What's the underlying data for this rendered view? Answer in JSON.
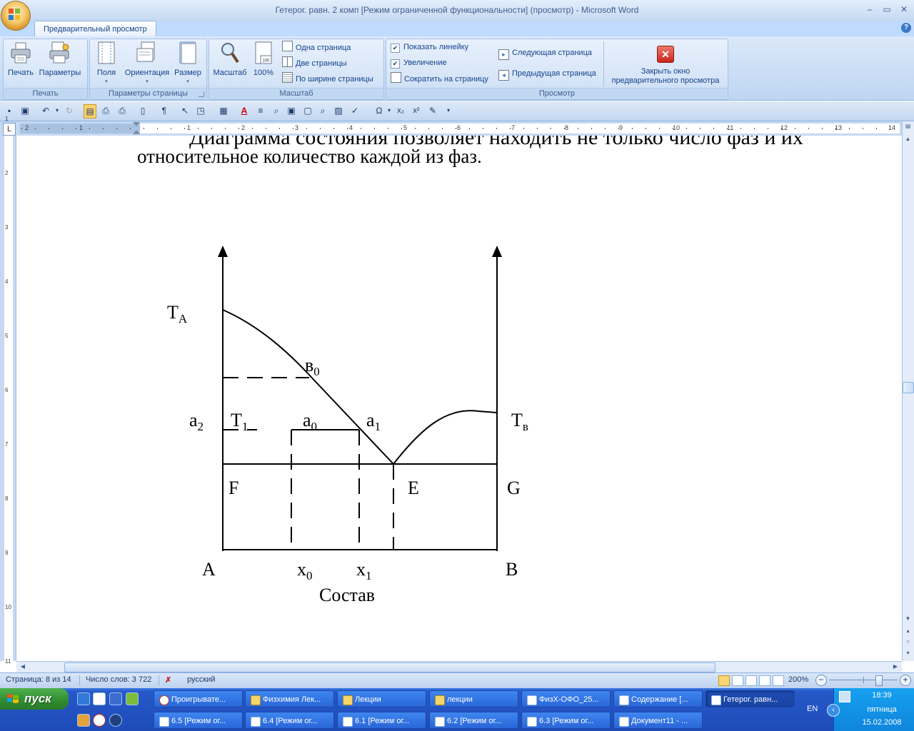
{
  "window": {
    "title": "Гетерог. равн. 2 комп [Режим ограниченной функциональности] (просмотр) - Microsoft Word",
    "minimize": "–",
    "restore": "▭",
    "close": "✕"
  },
  "ribbon": {
    "active_tab": "Предварительный просмотр",
    "help": "?",
    "groups": {
      "print": {
        "label": "Печать",
        "print_button": "Печать",
        "options_button": "Параметры"
      },
      "page_setup": {
        "label": "Параметры страницы",
        "margins_button": "Поля",
        "orientation_button": "Ориентация",
        "size_button": "Размер"
      },
      "zoom": {
        "label": "Масштаб",
        "zoom_button": "Масштаб",
        "zoom100_button": "100%",
        "zoom100_icon_text": "100",
        "one_page": "Одна страница",
        "two_pages": "Две страницы",
        "page_width": "По ширине страницы"
      },
      "preview": {
        "label": "Просмотр",
        "show_ruler": "Показать линейку",
        "show_ruler_checked": true,
        "magnifier": "Увеличение",
        "magnifier_checked": true,
        "shrink_one_page": "Сократить на страницу",
        "next_page": "Следующая страница",
        "previous_page": "Предыдущая страница",
        "close_preview": "Закрыть окно предварительного просмотра",
        "close_preview_line1": "Закрыть окно",
        "close_preview_line2": "предварительного просмотра"
      }
    }
  },
  "ruler": {
    "horizontal_ticks": [
      "2",
      "1",
      "1",
      "2",
      "3",
      "4",
      "5",
      "6",
      "7",
      "8",
      "9",
      "10",
      "11",
      "12",
      "13",
      "14"
    ],
    "vertical_ticks": [
      "1",
      "2",
      "3",
      "4",
      "5",
      "6",
      "7",
      "8",
      "9",
      "10",
      "11"
    ],
    "tab_selector": "L"
  },
  "document": {
    "partial_line": "Диаграмма состояния позволяет находить не только число фаз и их",
    "text_line": "относительное количество каждой из фаз.",
    "diagram_labels": {
      "TA": "T",
      "TA_sub": "A",
      "b0": "в",
      "b0_sub": "0",
      "a2": "a",
      "a2_sub": "2",
      "T1": "T",
      "T1_sub": "1",
      "a0": "a",
      "a0_sub": "0",
      "a1": "a",
      "a1_sub": "1",
      "Tb": "T",
      "Tb_sub": "в",
      "F": "F",
      "E": "E",
      "G": "G",
      "A": "A",
      "B": "B",
      "x0": "x",
      "x0_sub": "0",
      "x1": "x",
      "x1_sub": "1",
      "composition": "Состав"
    }
  },
  "statusbar": {
    "page": "Страница: 8 из 14",
    "words": "Число слов: 3 722",
    "language": "русский",
    "zoom": "200%",
    "zoom_level_percent": 200
  },
  "taskbar": {
    "start": "пуск",
    "tasks_row1": [
      {
        "label": "Проигрывате...",
        "icon": "media"
      },
      {
        "label": "Физхимия Лек...",
        "icon": "folder"
      },
      {
        "label": "Лекции",
        "icon": "folder"
      },
      {
        "label": "лекции",
        "icon": "folder"
      },
      {
        "label": "ФизХ-ОФО_25...",
        "icon": "word"
      },
      {
        "label": "Содержание [...",
        "icon": "word"
      },
      {
        "label": "Гетерог. равн...",
        "icon": "word",
        "active": true
      }
    ],
    "tasks_row2": [
      {
        "label": "6.5 [Режим ог...",
        "icon": "word"
      },
      {
        "label": "6.4 [Режим ог...",
        "icon": "word"
      },
      {
        "label": "6.1 [Режим ог...",
        "icon": "word"
      },
      {
        "label": "6.2 [Режим ог...",
        "icon": "word"
      },
      {
        "label": "6.3 [Режим ог...",
        "icon": "word"
      },
      {
        "label": "Документ11 - ...",
        "icon": "word"
      }
    ],
    "language_indicator": "EN",
    "clock_time": "18:39",
    "clock_day": "пятница",
    "clock_date": "15.02.2008"
  },
  "colors": {
    "ribbon_text": "#15428b",
    "taskbar_blue": "#2353c2",
    "start_green": "#2f8c2f",
    "tray_blue": "#0f85dc"
  }
}
